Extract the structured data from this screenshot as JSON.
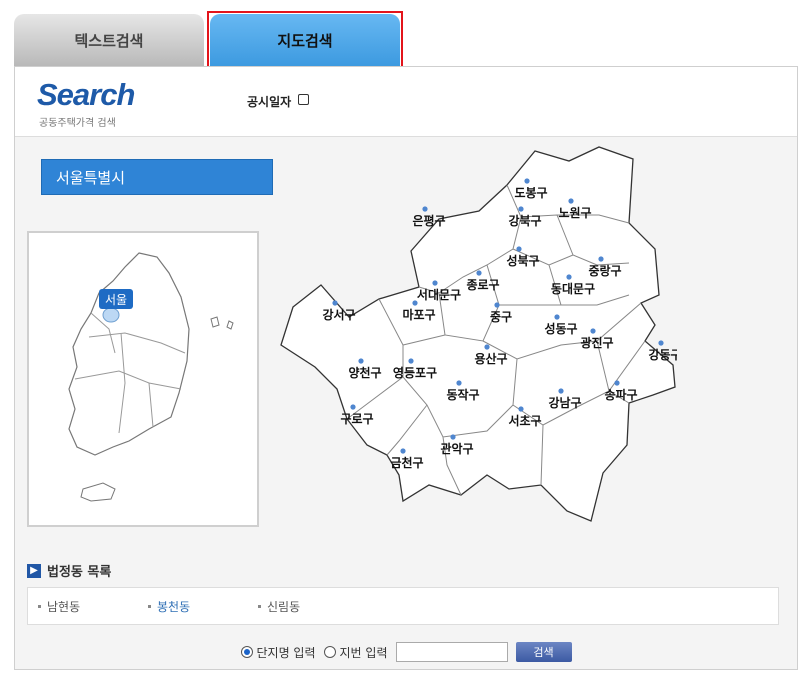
{
  "tabs": [
    {
      "label": "텍스트검색",
      "active": false
    },
    {
      "label": "지도검색",
      "active": true
    }
  ],
  "header": {
    "logo": "Search",
    "logo_sub": "공동주택가격 검색",
    "date_label": "공시일자"
  },
  "region": {
    "label": "서울특별시"
  },
  "minimap": {
    "label": "서울"
  },
  "districts": [
    "도봉구",
    "노원구",
    "강북구",
    "은평구",
    "성북구",
    "중랑구",
    "종로구",
    "서대문구",
    "동대문구",
    "강서구",
    "마포구",
    "중구",
    "성동구",
    "광진구",
    "강동구",
    "양천구",
    "영등포구",
    "용산구",
    "동작구",
    "강남구",
    "송파구",
    "구로구",
    "서초구",
    "관악구",
    "금천구"
  ],
  "dong_list": {
    "title": "법정동 목록",
    "items": [
      {
        "label": "남현동",
        "active": false
      },
      {
        "label": "봉천동",
        "active": true
      },
      {
        "label": "신림동",
        "active": false
      }
    ]
  },
  "search": {
    "option_complex": "단지명 입력",
    "option_lot": "지번 입력",
    "input_value": "",
    "button_label": "검색"
  },
  "colors": {
    "active_tab": "#4fa9ec",
    "highlight_border": "#e3141b",
    "region_bar": "#2f84d6",
    "district_dot": "#4f86cf"
  }
}
